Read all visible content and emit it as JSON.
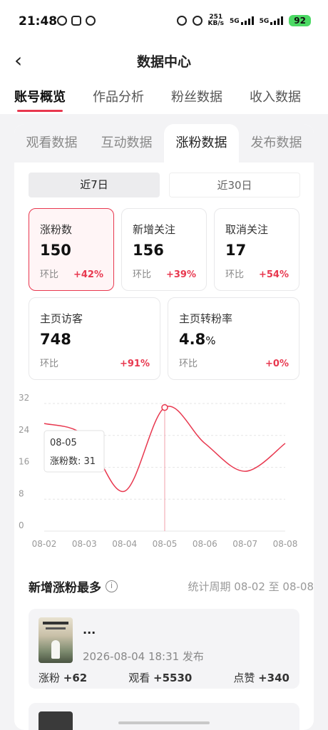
{
  "status": {
    "time": "21:48",
    "speed_top": "251",
    "speed_unit": "KB/s",
    "signal_1": "5G",
    "signal_2": "5G",
    "battery": "92"
  },
  "header": {
    "back_icon": "chevron-left-icon",
    "title": "数据中心",
    "tabs": [
      {
        "label": "账号概览",
        "active": true
      },
      {
        "label": "作品分析",
        "active": false
      },
      {
        "label": "粉丝数据",
        "active": false
      },
      {
        "label": "收入数据",
        "active": false
      }
    ]
  },
  "sub_tabs": [
    {
      "label": "观看数据",
      "active": false
    },
    {
      "label": "互动数据",
      "active": false
    },
    {
      "label": "涨粉数据",
      "active": true
    },
    {
      "label": "发布数据",
      "active": false
    }
  ],
  "ranges": {
    "r7": "近7日",
    "r30": "近30日",
    "selected": "近7日"
  },
  "stats": [
    {
      "label": "涨粉数",
      "value": "150",
      "unit": "",
      "cmp": "环比",
      "pct": "+42%"
    },
    {
      "label": "新增关注",
      "value": "156",
      "unit": "",
      "cmp": "环比",
      "pct": "+39%"
    },
    {
      "label": "取消关注",
      "value": "17",
      "unit": "",
      "cmp": "环比",
      "pct": "+54%"
    },
    {
      "label": "主页访客",
      "value": "748",
      "unit": "",
      "cmp": "环比",
      "pct": "+91%"
    },
    {
      "label": "主页转粉率",
      "value": "4.8",
      "unit": "%",
      "cmp": "环比",
      "pct": "+0%"
    }
  ],
  "chart_data": {
    "type": "line",
    "x": [
      "08-02",
      "08-03",
      "08-04",
      "08-05",
      "08-06",
      "08-07",
      "08-08"
    ],
    "series": [
      {
        "values": [
          27,
          24,
          10,
          31,
          22,
          15,
          22
        ]
      }
    ],
    "ylim": [
      0,
      32
    ],
    "yticks": [
      0,
      8,
      16,
      24,
      32
    ],
    "grid": true,
    "highlight_index": 3,
    "tooltip": {
      "date": "08-05",
      "text": "涨粉数: 31"
    },
    "line_color": "#e8384f"
  },
  "section": {
    "title": "新增涨粉最多",
    "info_icon": "info-icon",
    "period": "统计周期 08-02 至 08-08"
  },
  "post": {
    "title": "...",
    "date": "2026-08-04 18:31 发布",
    "fans_label": "涨粉",
    "fans": "+62",
    "views_label": "观看",
    "views": "+5530",
    "likes_label": "点赞",
    "likes": "+340"
  },
  "colors": {
    "accent": "#e8384f",
    "battery": "#4cd964"
  }
}
